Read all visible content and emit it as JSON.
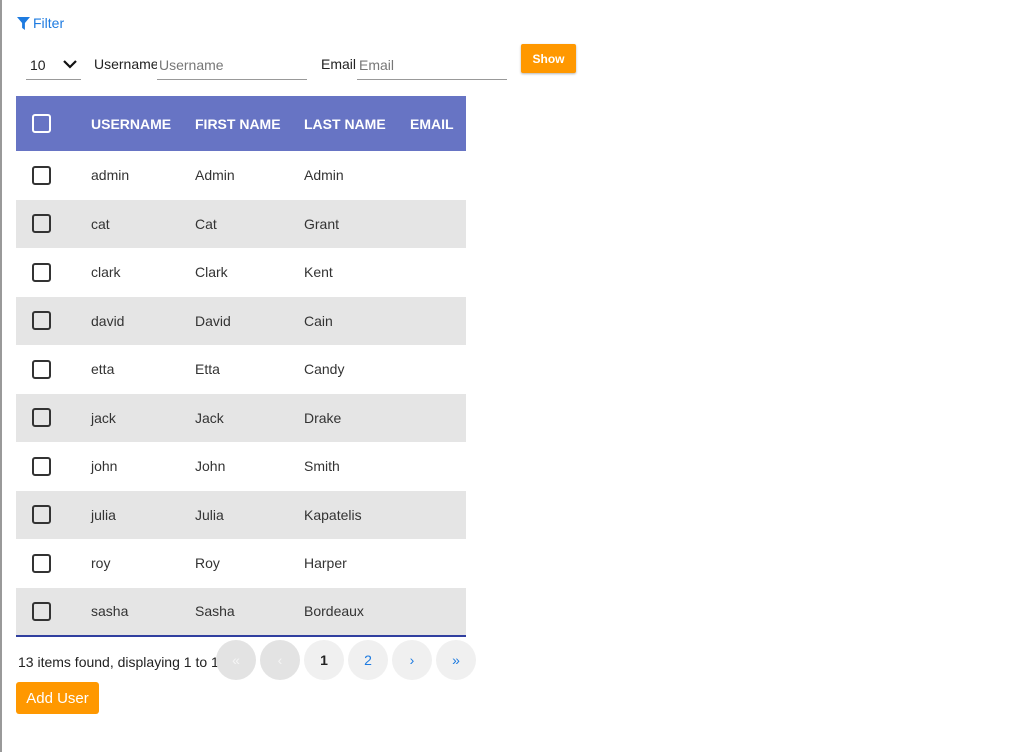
{
  "filter": {
    "label": "Filter"
  },
  "toolbar": {
    "page_size": "10",
    "username_label": "Username",
    "username_placeholder": "Username",
    "username_value": "",
    "email_label": "Email",
    "email_placeholder": "Email",
    "email_value": "",
    "show_label": "Show"
  },
  "table": {
    "headers": [
      "USERNAME",
      "FIRST NAME",
      "LAST NAME",
      "EMAIL"
    ],
    "rows": [
      [
        "admin",
        "Admin",
        "Admin",
        ""
      ],
      [
        "cat",
        "Cat",
        "Grant",
        ""
      ],
      [
        "clark",
        "Clark",
        "Kent",
        ""
      ],
      [
        "david",
        "David",
        "Cain",
        ""
      ],
      [
        "etta",
        "Etta",
        "Candy",
        ""
      ],
      [
        "jack",
        "Jack",
        "Drake",
        ""
      ],
      [
        "john",
        "John",
        "Smith",
        ""
      ],
      [
        "julia",
        "Julia",
        "Kapatelis",
        ""
      ],
      [
        "roy",
        "Roy",
        "Harper",
        ""
      ],
      [
        "sasha",
        "Sasha",
        "Bordeaux",
        ""
      ]
    ]
  },
  "status": "13 items found, displaying 1 to 10.",
  "pagination": {
    "first": "«",
    "prev": "‹",
    "pages": [
      "1",
      "2"
    ],
    "next": "›",
    "last": "»",
    "current": "1"
  },
  "add_user_label": "Add User",
  "colors": {
    "header": "#6774c4",
    "accent": "#ff9800",
    "link": "#1e7be0"
  }
}
